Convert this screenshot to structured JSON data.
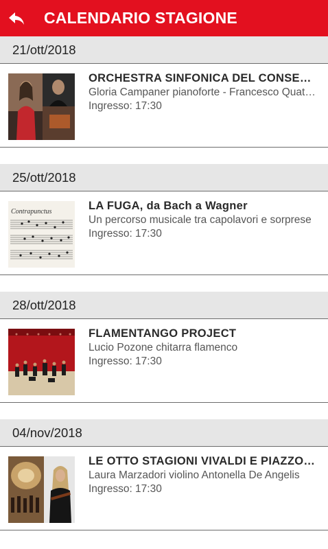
{
  "header": {
    "title": "CALENDARIO STAGIONE",
    "back_icon": "back-arrow-icon",
    "color": "#e3101f"
  },
  "events": [
    {
      "date": "21/ott/2018",
      "title": "ORCHESTRA SINFONICA DEL CONSERVATORIO",
      "subtitle": "Gloria Campaner pianoforte - Francesco Quattrocchi",
      "time": "Ingresso: 17:30"
    },
    {
      "date": "25/ott/2018",
      "title": "LA FUGA, da Bach a Wagner",
      "subtitle": "Un percorso musicale tra capolavori e sorprese",
      "time": "Ingresso: 17:30"
    },
    {
      "date": "28/ott/2018",
      "title": "FLAMENTANGO PROJECT",
      "subtitle": "Lucio Pozone chitarra flamenco",
      "time": "Ingresso: 17:30"
    },
    {
      "date": "04/nov/2018",
      "title": "LE OTTO STAGIONI VIVALDI E PIAZZOLLA",
      "subtitle": "Laura Marzadori violino Antonella De Angelis",
      "time": "Ingresso: 17:30"
    }
  ]
}
